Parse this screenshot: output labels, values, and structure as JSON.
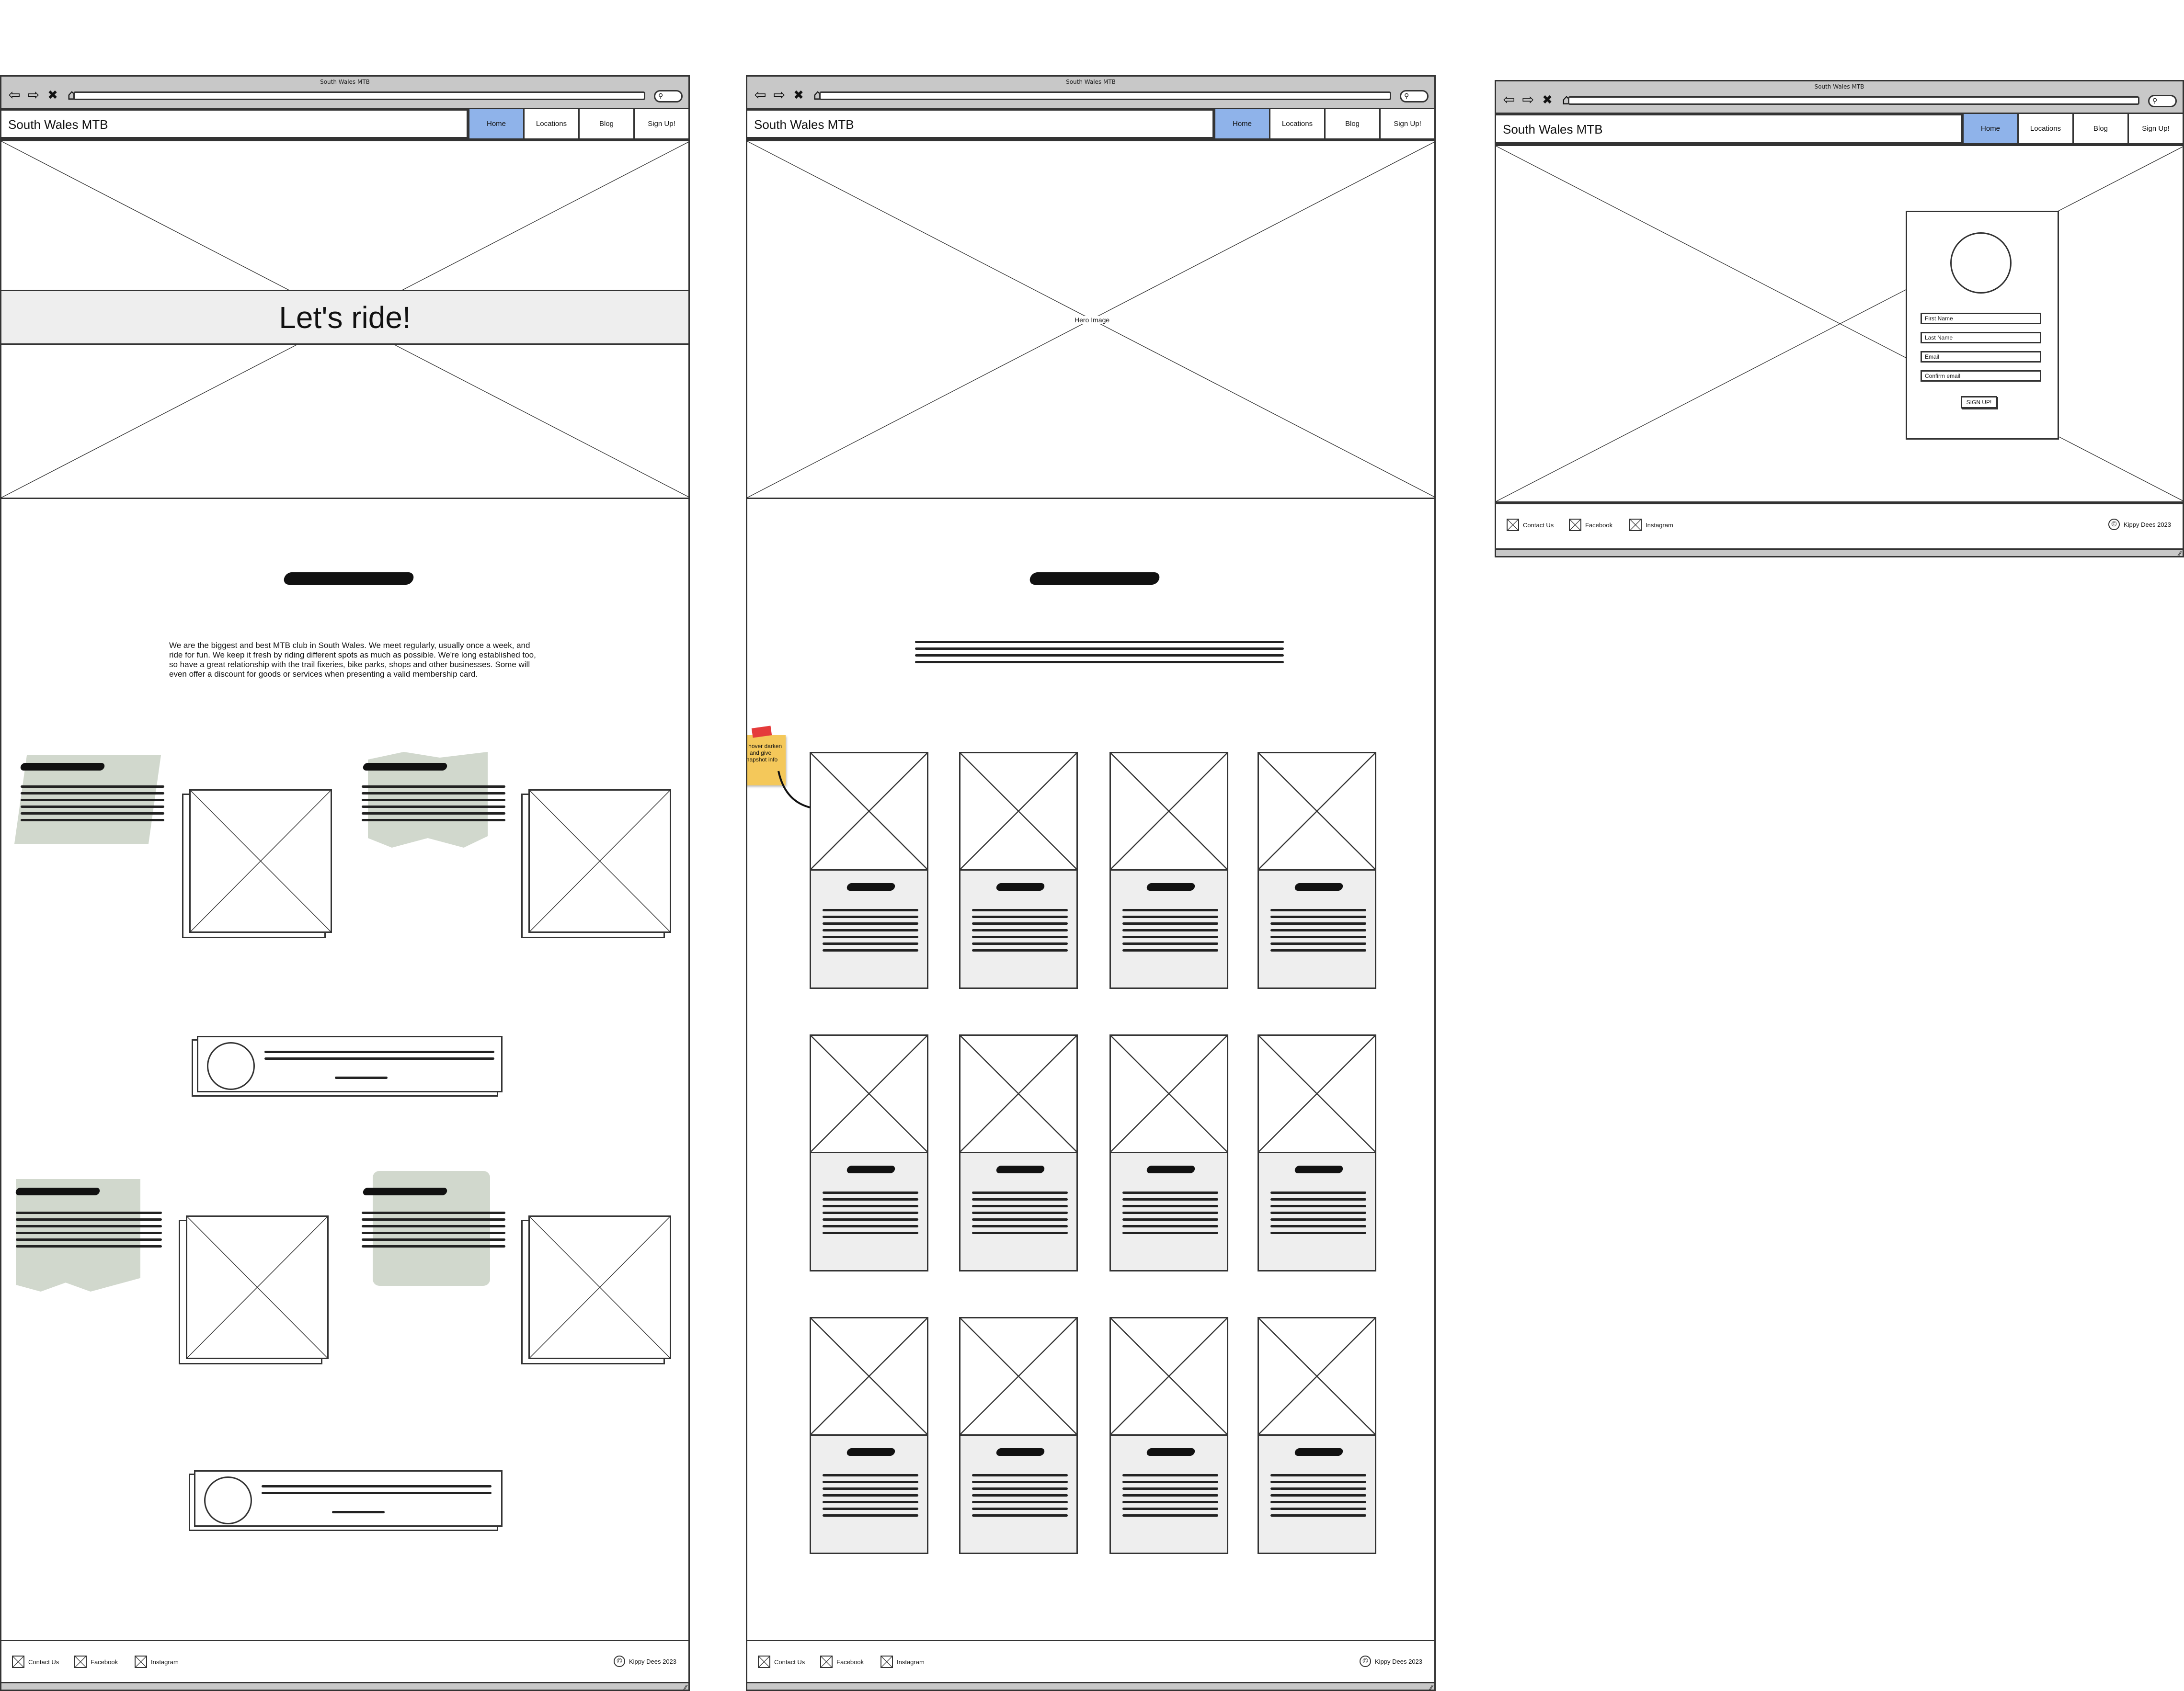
{
  "window": {
    "title": "South Wales MTB"
  },
  "brand": "South Wales MTB",
  "nav": [
    "Home",
    "Locations",
    "Blog",
    "Sign Up!"
  ],
  "colors": {
    "nav_active": "#8fb3ea",
    "panel_fill": "#eeeeee",
    "blob_fill": "#d1d8cd",
    "sticky_note": "#f4c85a",
    "pin": "#e53b3b"
  },
  "home": {
    "hero_heading": "Let's ride!",
    "intro": "We are the biggest and best MTB club in South Wales. We meet regularly, usually once a week, and ride for fun. We keep it fresh by riding different spots as much as possible. We're long established too, so have a great relationship with the trail fixeries, bike parks, shops and other businesses. Some will even offer a discount for goods or services when presenting a valid membership card."
  },
  "locations": {
    "hero_label": "Hero Image",
    "sticky_note": "On hover darken and give snapshot info"
  },
  "signup": {
    "fields": [
      "First Name",
      "Last Name",
      "Email",
      "Confirm email"
    ],
    "button": "SIGN UP!"
  },
  "footer": {
    "links": [
      "Contact Us",
      "Facebook",
      "Instagram"
    ],
    "copyright": "Kippy Dees 2023",
    "copy_symbol": "©"
  }
}
